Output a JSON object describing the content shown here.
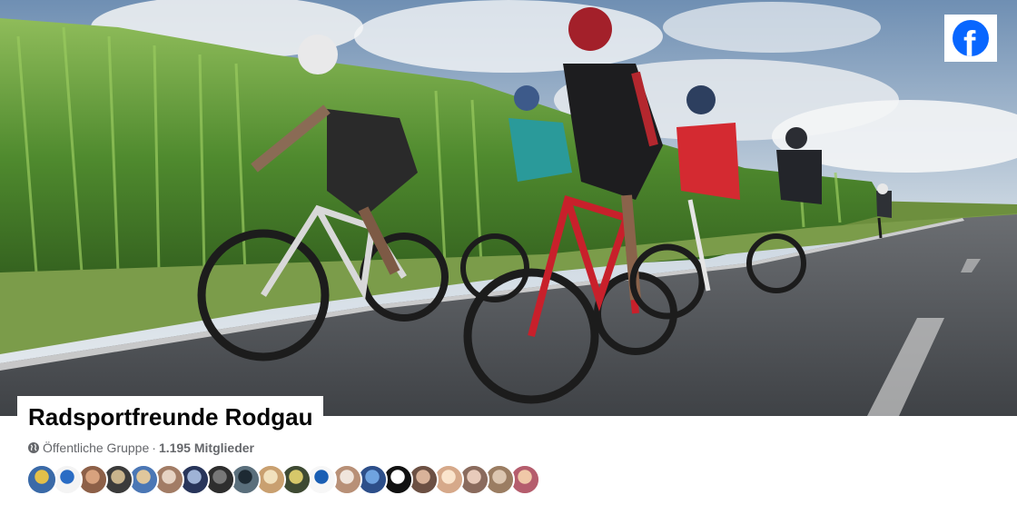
{
  "group": {
    "name": "Radsportfreunde Rodgau",
    "privacy": "Öffentliche Gruppe",
    "separator": "·",
    "member_count": "1.195 Mitglieder"
  },
  "cover": {
    "description_icon": "facebook-logo-icon"
  },
  "avatars": [
    {
      "bg": "#3a6aa8",
      "fg": "#e3c04a"
    },
    {
      "bg": "#f4f4f4",
      "fg": "#2a6cc4"
    },
    {
      "bg": "#8d6048",
      "fg": "#d8a27e"
    },
    {
      "bg": "#3b3b3b",
      "fg": "#c9b48c"
    },
    {
      "bg": "#4b77b5",
      "fg": "#e0c79c"
    },
    {
      "bg": "#a27c65",
      "fg": "#e6d3c3"
    },
    {
      "bg": "#28355a",
      "fg": "#9fb3d6"
    },
    {
      "bg": "#2e2e2e",
      "fg": "#777777"
    },
    {
      "bg": "#5a6f7c",
      "fg": "#1d2a33"
    },
    {
      "bg": "#c9a070",
      "fg": "#f1e1bd"
    },
    {
      "bg": "#3e4a33",
      "fg": "#d6c86a"
    },
    {
      "bg": "#f7f7f7",
      "fg": "#1a5fb4"
    },
    {
      "bg": "#b89077",
      "fg": "#f0e5dc"
    },
    {
      "bg": "#2d4f8a",
      "fg": "#6fa3e0"
    },
    {
      "bg": "#111111",
      "fg": "#ffffff"
    },
    {
      "bg": "#6c5043",
      "fg": "#d9b39a"
    },
    {
      "bg": "#d6a98a",
      "fg": "#fae4cc"
    },
    {
      "bg": "#8a6b5d",
      "fg": "#e8cbbb"
    },
    {
      "bg": "#9b7d62",
      "fg": "#dcc6b0"
    },
    {
      "bg": "#b55d6d",
      "fg": "#f0c8a8"
    }
  ],
  "colors": {
    "facebook_blue": "#0866ff",
    "text_primary": "#050505",
    "text_secondary": "#65676b"
  }
}
